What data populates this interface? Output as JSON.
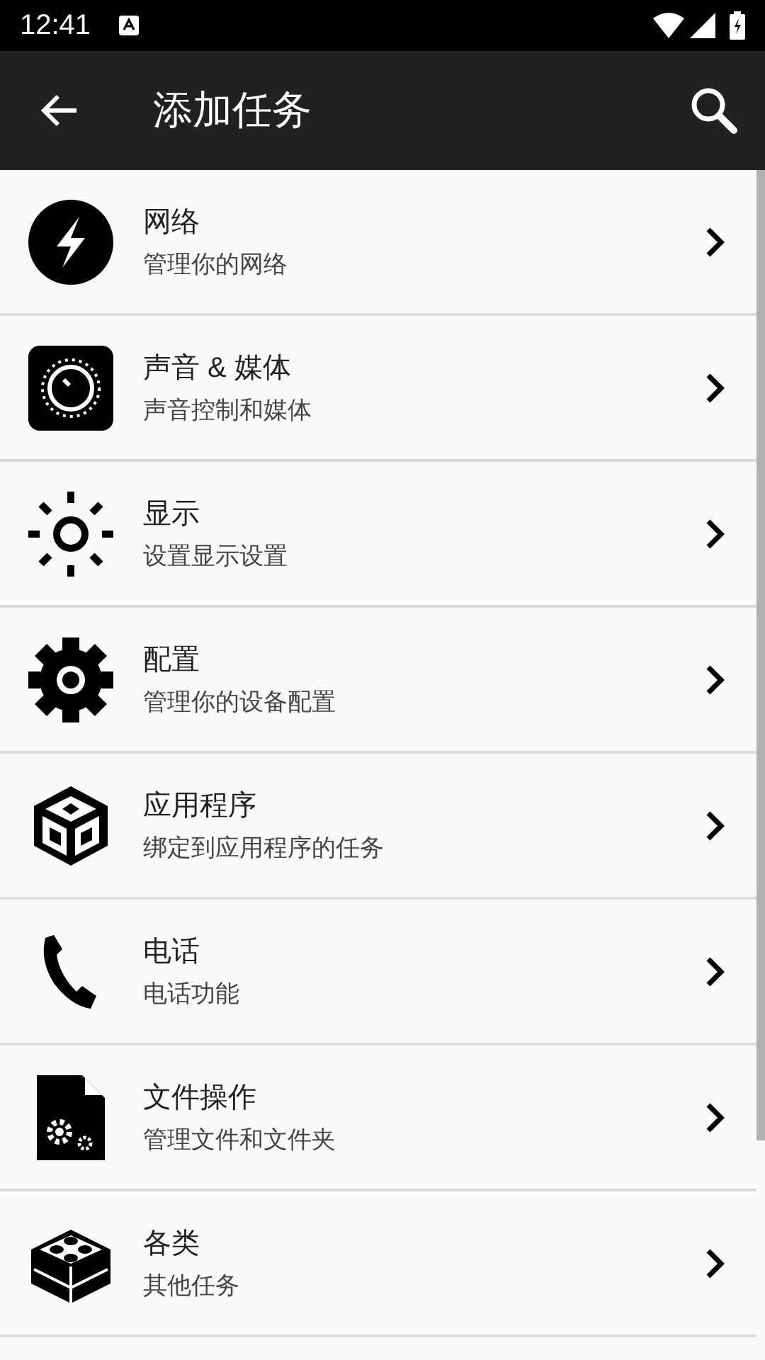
{
  "status_bar": {
    "time": "12:41"
  },
  "toolbar": {
    "title": "添加任务"
  },
  "items": [
    {
      "kind": "bolt",
      "title": "网络",
      "subtitle": "管理你的网络"
    },
    {
      "kind": "knob",
      "title": "声音 & 媒体",
      "subtitle": "声音控制和媒体"
    },
    {
      "kind": "sun",
      "title": "显示",
      "subtitle": "设置显示设置"
    },
    {
      "kind": "gear",
      "title": "配置",
      "subtitle": "管理你的设备配置"
    },
    {
      "kind": "cube",
      "title": "应用程序",
      "subtitle": "绑定到应用程序的任务"
    },
    {
      "kind": "phone",
      "title": "电话",
      "subtitle": "电话功能"
    },
    {
      "kind": "file",
      "title": "文件操作",
      "subtitle": "管理文件和文件夹"
    },
    {
      "kind": "blocks",
      "title": "各类",
      "subtitle": "其他任务"
    }
  ]
}
